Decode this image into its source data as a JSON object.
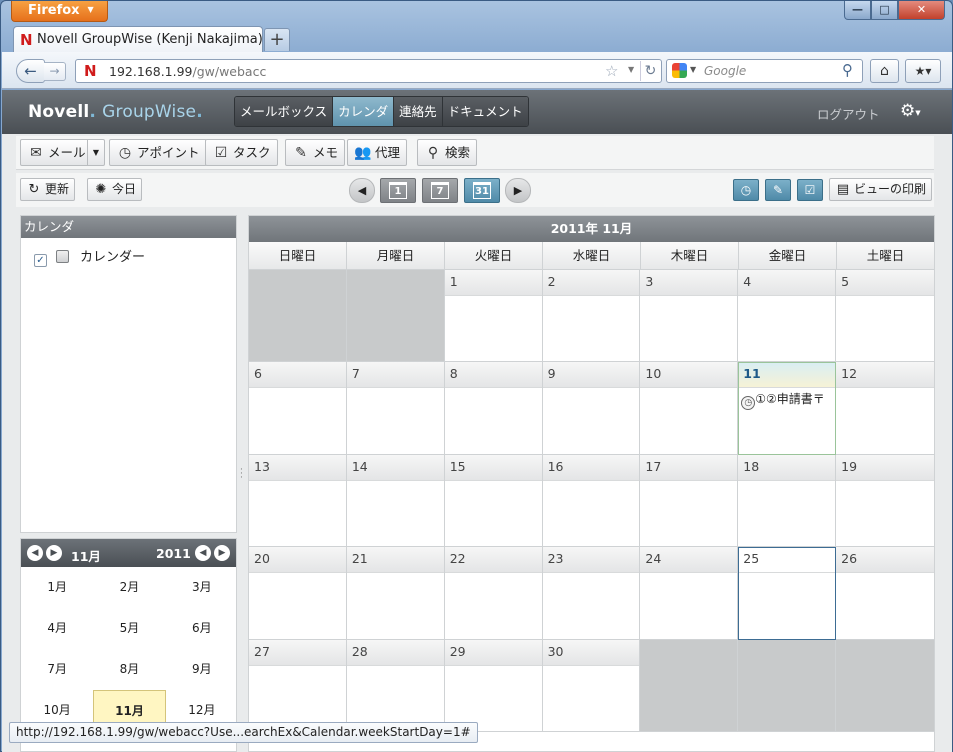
{
  "browser": {
    "menu_label": "Firefox",
    "tab_title": "Novell GroupWise (Kenji Nakajima)",
    "url_host": "192.168.1.99",
    "url_path": "/gw/webacc",
    "search_placeholder": "Google",
    "status_url": "http://192.168.1.99/gw/webacc?Use...earchEx&Calendar.weekStartDay=1#"
  },
  "app": {
    "logo_novell": "Novell",
    "logo_groupwise": "GroupWise",
    "tabs": [
      {
        "label": "メールボックス"
      },
      {
        "label": "カレンダ"
      },
      {
        "label": "連絡先"
      },
      {
        "label": "ドキュメント"
      }
    ],
    "logout": "ログアウト"
  },
  "toolbar": {
    "mail": "メール",
    "appointment": "アポイント",
    "task": "タスク",
    "memo": "メモ",
    "proxy": "代理",
    "search": "検索",
    "refresh": "更新",
    "today": "今日",
    "view_day": "1",
    "view_week": "7",
    "view_month": "31",
    "print_view": "ビューの印刷"
  },
  "sidebar": {
    "header": "カレンダ",
    "calendar_label": "カレンダー"
  },
  "minical": {
    "month": "11月",
    "year": "2011",
    "months": [
      "1月",
      "2月",
      "3月",
      "4月",
      "5月",
      "6月",
      "7月",
      "8月",
      "9月",
      "10月",
      "11月",
      "12月"
    ]
  },
  "calendar": {
    "title": "2011年 11月",
    "weekdays": [
      "日曜日",
      "月曜日",
      "火曜日",
      "水曜日",
      "木曜日",
      "金曜日",
      "土曜日"
    ],
    "days": [
      "",
      "",
      "1",
      "2",
      "3",
      "4",
      "5",
      "6",
      "7",
      "8",
      "9",
      "10",
      "11",
      "12",
      "13",
      "14",
      "15",
      "16",
      "17",
      "18",
      "19",
      "20",
      "21",
      "22",
      "23",
      "24",
      "25",
      "26",
      "27",
      "28",
      "29",
      "30",
      "",
      "",
      ""
    ],
    "today": "11",
    "selected": "25",
    "appointment": {
      "day": "11",
      "text": "①②申請書〒"
    }
  }
}
